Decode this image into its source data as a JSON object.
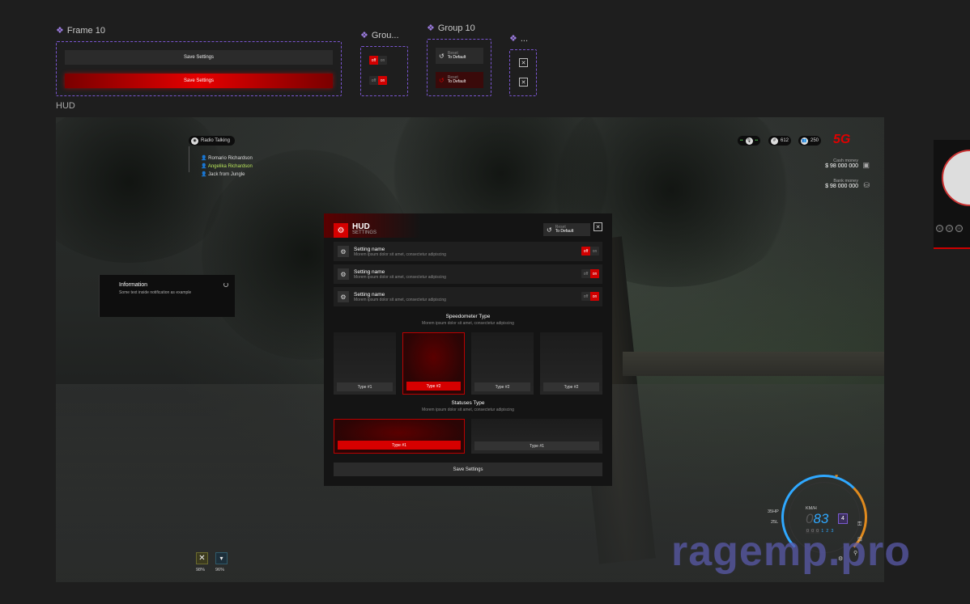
{
  "top": {
    "frame10": {
      "title": "Frame 10",
      "save_label": "Save Settings",
      "save_active_label": "Save Settings"
    },
    "group_toggles": {
      "title": "Grou...",
      "off": "off",
      "on": "on"
    },
    "group10": {
      "title": "Group 10",
      "reset_line1": "Reset",
      "reset_line2": "To Default"
    },
    "close_group": {
      "title": "..."
    }
  },
  "hud_label": "HUD",
  "radio": {
    "title": "Radio Talking",
    "members": [
      "Romario Richardson",
      "Angelika Richardson",
      "Jack from Jungle"
    ],
    "active_index": 1
  },
  "notification": {
    "title": "Information",
    "text": "Some text inside notification as example"
  },
  "top_right": {
    "ids": "612",
    "players": "250",
    "logo": "5G"
  },
  "money": {
    "cash_label": "Cash money",
    "cash_value": "$ 98 000 000",
    "bank_label": "Bank money",
    "bank_value": "$ 98 000 000"
  },
  "settings": {
    "title": "HUD",
    "subtitle": "SETTINGS",
    "reset_line1": "Reset",
    "reset_line2": "To Default",
    "rows": [
      {
        "name": "Setting name",
        "desc": "Morem ipsum dolor sit amet, consectetur adipiscing",
        "state": "off"
      },
      {
        "name": "Setting name",
        "desc": "Morem ipsum dolor sit amet, consectetur adipiscing",
        "state": "on"
      },
      {
        "name": "Setting name",
        "desc": "Morem ipsum dolor sit amet, consectetur adipiscing",
        "state": "on"
      }
    ],
    "off_label": "off",
    "on_label": "on",
    "speedo_title": "Speedometer Type",
    "speedo_desc": "Morem ipsum dolor sit amet, consectetur adipiscing",
    "speedo_types": [
      "Type #1",
      "Type #2",
      "Type #2",
      "Type #2"
    ],
    "speedo_selected": 1,
    "status_title": "Statuses Type",
    "status_desc": "Morem ipsum dolor sit amet, consectetur adipiscing",
    "status_types": [
      "Type #1",
      "Type #1"
    ],
    "status_selected": 0,
    "save_label": "Save Settings"
  },
  "statuses": [
    {
      "value": "98%",
      "icon": "fork-knife-icon"
    },
    {
      "value": "96%",
      "icon": "cup-icon"
    }
  ],
  "speedometer": {
    "unit": "KM/H",
    "speed": "83",
    "speed_ghost": "0",
    "gear": "4",
    "hp": "35HP",
    "fuel": "25L",
    "odometer": [
      "0",
      "0",
      "0",
      "1",
      "2",
      "3"
    ]
  },
  "watermark": "ragemp.pro",
  "colors": {
    "accent": "#d60000",
    "frame_border": "#7a55d0",
    "speed_blue": "#2fa8ff",
    "speed_orange": "#e08a1e",
    "radio_active": "#b6e35a"
  }
}
